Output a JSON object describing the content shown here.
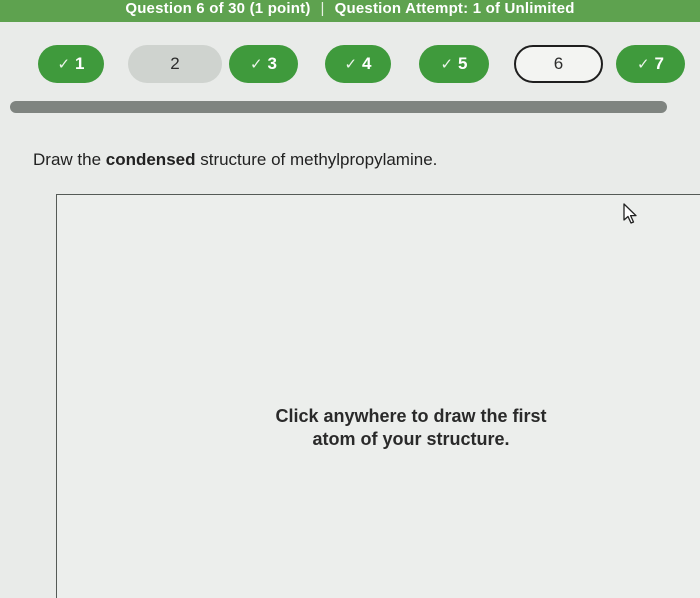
{
  "header": {
    "question_info": "Question 6 of 30 (1 point)",
    "separator": "|",
    "attempt_info": "Question Attempt: 1 of Unlimited"
  },
  "nav": {
    "check_glyph": "✓",
    "questions": [
      {
        "label": "1",
        "status": "done"
      },
      {
        "label": "2",
        "status": "pending"
      },
      {
        "label": "3",
        "status": "done"
      },
      {
        "label": "4",
        "status": "done"
      },
      {
        "label": "5",
        "status": "done"
      },
      {
        "label": "6",
        "status": "current"
      },
      {
        "label": "7",
        "status": "done"
      }
    ]
  },
  "question": {
    "prefix": "Draw the ",
    "emphasis": "condensed",
    "suffix": " structure of methylpropylamine."
  },
  "canvas": {
    "message_line1": "Click anywhere to draw the first",
    "message_line2": "atom of your structure."
  },
  "icons": {
    "cursor": "mouse-pointer-icon"
  },
  "colors": {
    "header_green": "#5ea24f",
    "done_green": "#3f9a3c",
    "pending_gray": "#cfd3cf",
    "progress_gray": "#7f8480"
  }
}
